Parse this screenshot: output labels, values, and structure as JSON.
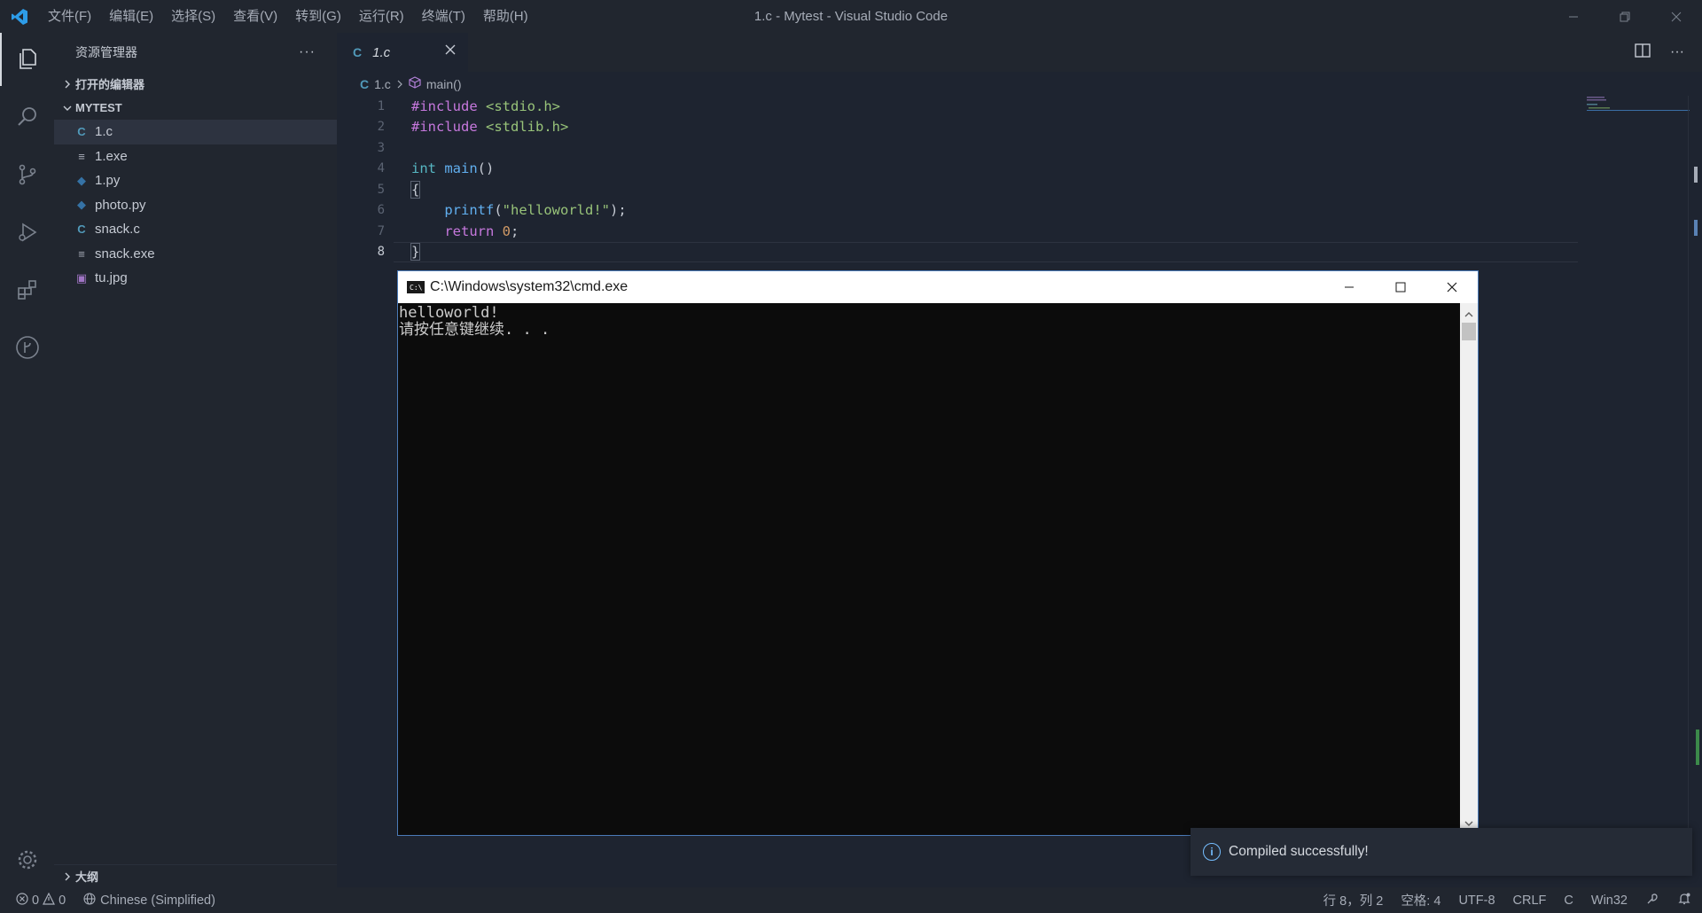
{
  "titlebar": {
    "menus": [
      "文件(F)",
      "编辑(E)",
      "选择(S)",
      "查看(V)",
      "转到(G)",
      "运行(R)",
      "终端(T)",
      "帮助(H)"
    ],
    "title": "1.c - Mytest - Visual Studio Code"
  },
  "sidebar": {
    "header": "资源管理器",
    "open_editors": "打开的编辑器",
    "folder": "MYTEST",
    "files": [
      {
        "name": "1.c",
        "icon": "c-file-icon",
        "glyph": "C",
        "color": "#519aba"
      },
      {
        "name": "1.exe",
        "icon": "binary-file-icon",
        "glyph": "≡",
        "color": "#a6acb7"
      },
      {
        "name": "1.py",
        "icon": "python-file-icon",
        "glyph": "◆",
        "color": "#3572a5"
      },
      {
        "name": "photo.py",
        "icon": "python-file-icon",
        "glyph": "◆",
        "color": "#3572a5"
      },
      {
        "name": "snack.c",
        "icon": "c-file-icon",
        "glyph": "C",
        "color": "#519aba"
      },
      {
        "name": "snack.exe",
        "icon": "binary-file-icon",
        "glyph": "≡",
        "color": "#a6acb7"
      },
      {
        "name": "tu.jpg",
        "icon": "image-file-icon",
        "glyph": "▣",
        "color": "#a074c4"
      }
    ],
    "outline": "大纲"
  },
  "editor": {
    "tab_label": "1.c",
    "breadcrumb_file": "1.c",
    "breadcrumb_symbol": "main()",
    "line_numbers": [
      "1",
      "2",
      "3",
      "4",
      "5",
      "6",
      "7",
      "8"
    ]
  },
  "cmd": {
    "title": "C:\\Windows\\system32\\cmd.exe",
    "output_line1": "helloworld!",
    "output_line2": "请按任意键继续. . ."
  },
  "notification": {
    "message": "Compiled successfully!"
  },
  "statusbar": {
    "errors": "0",
    "warnings": "0",
    "language_pack": "Chinese (Simplified)",
    "cursor": "行 8，列 2",
    "indent": "空格: 4",
    "encoding": "UTF-8",
    "eol": "CRLF",
    "language": "C",
    "platform": "Win32"
  },
  "colors": {
    "accent": "#007acc",
    "background": "#1e2430",
    "panel": "#21262f"
  }
}
